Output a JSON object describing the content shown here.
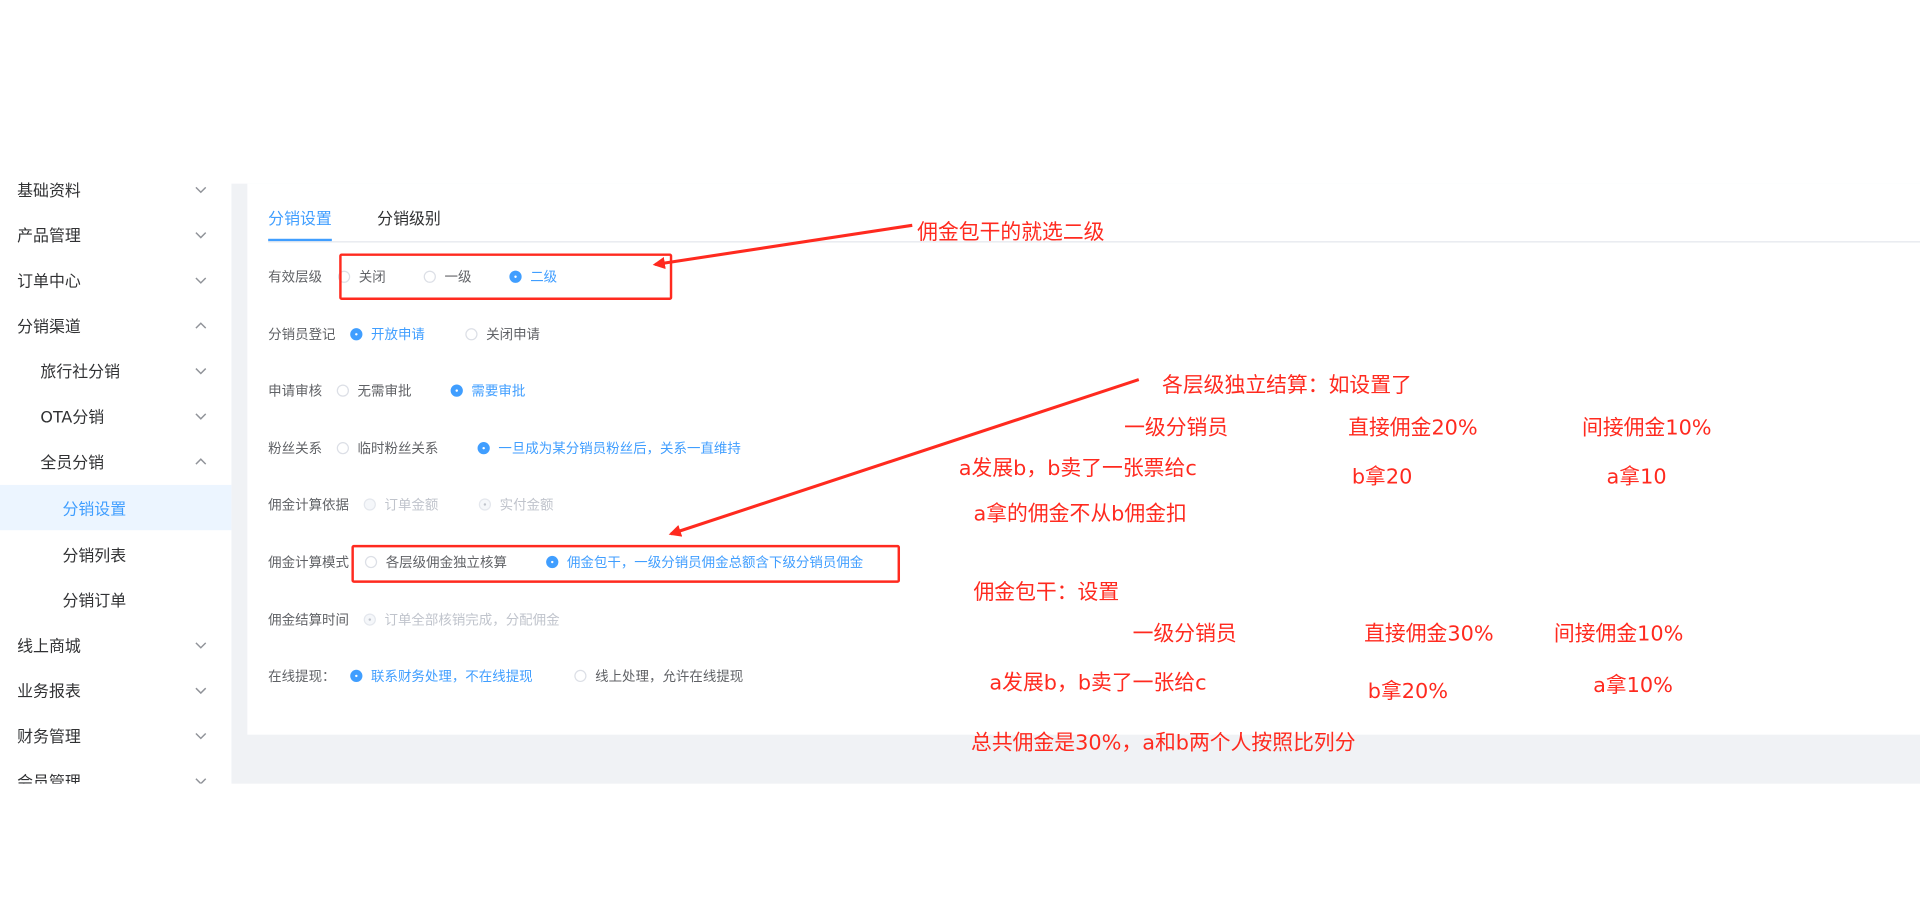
{
  "sidebar": {
    "items": [
      {
        "label": "基础资料",
        "chevron": "chevron-down-icon"
      },
      {
        "label": "产品管理",
        "chevron": "chevron-down-icon"
      },
      {
        "label": "订单中心",
        "chevron": "chevron-down-icon"
      },
      {
        "label": "分销渠道",
        "chevron": "chevron-up-icon"
      },
      {
        "label": "旅行社分销",
        "chevron": "chevron-down-icon"
      },
      {
        "label": "OTA分销",
        "chevron": "chevron-down-icon"
      },
      {
        "label": "全员分销",
        "chevron": "chevron-up-icon"
      },
      {
        "label": "分销设置",
        "active": true
      },
      {
        "label": "分销列表"
      },
      {
        "label": "分销订单"
      },
      {
        "label": "线上商城",
        "chevron": "chevron-down-icon"
      },
      {
        "label": "业务报表",
        "chevron": "chevron-down-icon"
      },
      {
        "label": "财务管理",
        "chevron": "chevron-down-icon"
      },
      {
        "label": "会员管理",
        "chevron": "chevron-down-icon"
      }
    ]
  },
  "tabs": [
    {
      "label": "分销设置",
      "active": true
    },
    {
      "label": "分销级别",
      "active": false
    }
  ],
  "form": {
    "rows": [
      {
        "label": "有效层级",
        "options": [
          {
            "text": "关闭",
            "checked": false
          },
          {
            "text": "一级",
            "checked": false
          },
          {
            "text": "二级",
            "checked": true
          }
        ]
      },
      {
        "label": "分销员登记",
        "options": [
          {
            "text": "开放申请",
            "checked": true
          },
          {
            "text": "关闭申请",
            "checked": false
          }
        ]
      },
      {
        "label": "申请审核",
        "options": [
          {
            "text": "无需审批",
            "checked": false
          },
          {
            "text": "需要审批",
            "checked": true
          }
        ]
      },
      {
        "label": "粉丝关系",
        "options": [
          {
            "text": "临时粉丝关系",
            "checked": false
          },
          {
            "text": "一旦成为某分销员粉丝后，关系一直维持",
            "checked": true
          }
        ]
      },
      {
        "label": "佣金计算依据",
        "options": [
          {
            "text": "订单金额",
            "checked": false,
            "disabled": true
          },
          {
            "text": "实付金额",
            "checked": true,
            "disabled": true
          }
        ]
      },
      {
        "label": "佣金计算模式",
        "options": [
          {
            "text": "各层级佣金独立核算",
            "checked": false
          },
          {
            "text": "佣金包干，一级分销员佣金总额含下级分销员佣金",
            "checked": true
          }
        ]
      },
      {
        "label": "佣金结算时间",
        "options": [
          {
            "text": "订单全部核销完成，分配佣金",
            "checked": true,
            "disabled": true
          }
        ]
      },
      {
        "label": "在线提现：",
        "options": [
          {
            "text": "联系财务处理，不在线提现",
            "checked": true
          },
          {
            "text": "线上处理，允许在线提现",
            "checked": false
          }
        ]
      }
    ]
  },
  "annotations": {
    "a1": "佣金包干的就选二级",
    "a2": "各层级独立结算：如设置了",
    "a3": "一级分销员",
    "a4": "直接佣金20%",
    "a5": "间接佣金10%",
    "a6": "a发展b，b卖了一张票给c",
    "a7": "b拿20",
    "a8": "a拿10",
    "a9": "a拿的佣金不从b佣金扣",
    "a10": "佣金包干：设置",
    "a11": "一级分销员",
    "a12": "直接佣金30%",
    "a13": "间接佣金10%",
    "a14": "a发展b，b卖了一张给c",
    "a15": "b拿20%",
    "a16": "a拿10%",
    "a17": "总共佣金是30%，a和b两个人按照比列分",
    "color": "#ff2a1f"
  },
  "theme": {
    "accent": "#409eff",
    "annotation": "#ff2a1f",
    "background": "#f0f2f5"
  }
}
